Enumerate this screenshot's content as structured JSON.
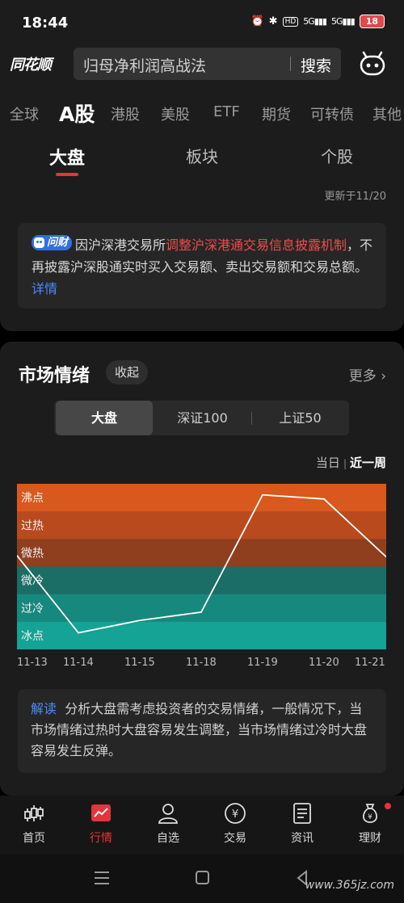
{
  "status_bar": {
    "time": "18:44",
    "hd_label": "HD",
    "net1": "5G",
    "net2": "5G",
    "battery": "18"
  },
  "header": {
    "logo": "同花顺",
    "search_text": "归母净利润高战法",
    "search_button": "搜索"
  },
  "market_tabs": [
    "全球",
    "A股",
    "港股",
    "美股",
    "ETF",
    "期货",
    "可转债",
    "其他"
  ],
  "market_tab_active": "A股",
  "sub_tabs": [
    "大盘",
    "板块",
    "个股"
  ],
  "updated_text": "更新于11/20",
  "notice": {
    "badge": "问财",
    "prefix": "因沪深港交易所",
    "highlight": "调整沪深港通交易信息披露机制",
    "suffix": "，不再披露沪深股通实时买入交易额、卖出交易额和交易总额。",
    "link": "详情"
  },
  "sentiment": {
    "title": "市场情绪",
    "collapse": "收起",
    "more": "更多",
    "segments": [
      "大盘",
      "深证100",
      "上证50"
    ],
    "periods": [
      "当日",
      "近一周"
    ],
    "active_period": "近一周",
    "interpret_label": "解读",
    "interpret_text": "分析大盘需考虑投资者的交易情绪，一般情况下，当市场情绪过热时大盘容易发生调整，当市场情绪过冷时大盘容易发生反弹。"
  },
  "chart_data": {
    "type": "line",
    "title": "",
    "x": [
      "11-13",
      "11-14",
      "11-15",
      "11-18",
      "11-19",
      "11-20",
      "11-21"
    ],
    "bands": [
      {
        "label": "沸点",
        "color": "#d9581d"
      },
      {
        "label": "过热",
        "color": "#b84a1e"
      },
      {
        "label": "微热",
        "color": "#8f3e1e"
      },
      {
        "label": "微冷",
        "color": "#1a6e66"
      },
      {
        "label": "过冷",
        "color": "#17887e"
      },
      {
        "label": "冰点",
        "color": "#14a395"
      }
    ],
    "series": [
      {
        "values": [
          3.4,
          0.6,
          1.05,
          1.35,
          5.6,
          5.45,
          3.35
        ]
      }
    ],
    "ylim": [
      0,
      6
    ],
    "line_color": "#ffffff"
  },
  "bottom_nav": [
    "首页",
    "行情",
    "自选",
    "交易",
    "资讯",
    "理财"
  ],
  "bottom_nav_active": "行情",
  "watermark": "www.365jz.com"
}
